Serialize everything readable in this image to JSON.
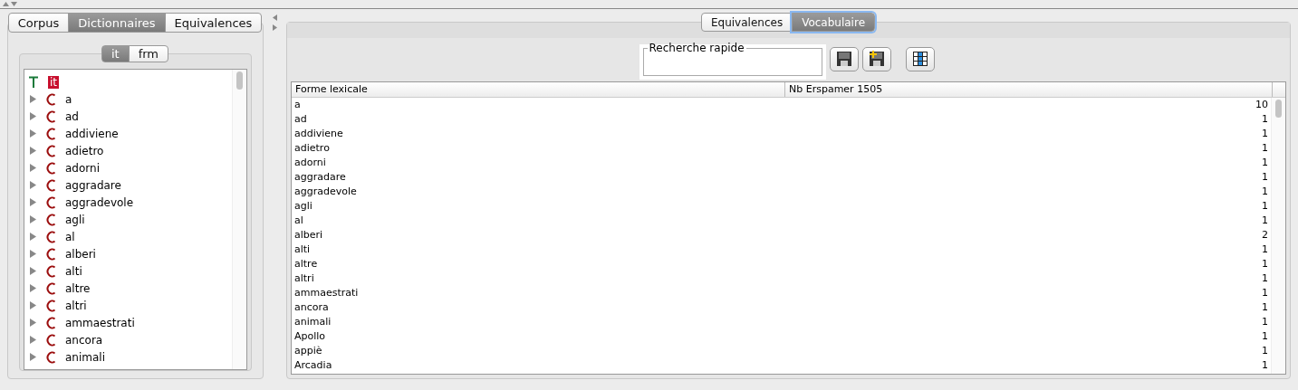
{
  "left_tabs": [
    {
      "label": "Corpus",
      "selected": false
    },
    {
      "label": "Dictionnaires",
      "selected": true
    },
    {
      "label": "Equivalences",
      "selected": false
    }
  ],
  "language_tabs": [
    {
      "label": "it",
      "selected": true
    },
    {
      "label": "frm",
      "selected": false
    }
  ],
  "tree": {
    "root": {
      "label": "it",
      "selected": true
    },
    "items": [
      {
        "label": "a",
        "expanded": false
      },
      {
        "label": "ad",
        "expanded": false
      },
      {
        "label": "addiviene",
        "expanded": false
      },
      {
        "label": "adietro",
        "expanded": false
      },
      {
        "label": "adorni",
        "expanded": false
      },
      {
        "label": "aggradare",
        "expanded": false
      },
      {
        "label": "aggradevole",
        "expanded": false
      },
      {
        "label": "agli",
        "expanded": false
      },
      {
        "label": "al",
        "expanded": false
      },
      {
        "label": "alberi",
        "expanded": false
      },
      {
        "label": "alti",
        "expanded": false
      },
      {
        "label": "altre",
        "expanded": false
      },
      {
        "label": "altri",
        "expanded": false
      },
      {
        "label": "ammaestrati",
        "expanded": false
      },
      {
        "label": "ancora",
        "expanded": false
      },
      {
        "label": "animali",
        "expanded": false
      }
    ]
  },
  "right_tabs": [
    {
      "label": "Equivalences",
      "selected": false
    },
    {
      "label": "Vocabulaire",
      "selected": true
    }
  ],
  "search": {
    "label": "Recherche rapide"
  },
  "table": {
    "columns": [
      "Forme lexicale",
      "Nb Erspamer 1505"
    ],
    "rows": [
      [
        "a",
        "10"
      ],
      [
        "ad",
        "1"
      ],
      [
        "addiviene",
        "1"
      ],
      [
        "adietro",
        "1"
      ],
      [
        "adorni",
        "1"
      ],
      [
        "aggradare",
        "1"
      ],
      [
        "aggradevole",
        "1"
      ],
      [
        "agli",
        "1"
      ],
      [
        "al",
        "1"
      ],
      [
        "alberi",
        "2"
      ],
      [
        "alti",
        "1"
      ],
      [
        "altre",
        "1"
      ],
      [
        "altri",
        "1"
      ],
      [
        "ammaestrati",
        "1"
      ],
      [
        "ancora",
        "1"
      ],
      [
        "animali",
        "1"
      ],
      [
        "Apollo",
        "1"
      ],
      [
        "appiè",
        "1"
      ],
      [
        "Arcadia",
        "1"
      ]
    ]
  }
}
